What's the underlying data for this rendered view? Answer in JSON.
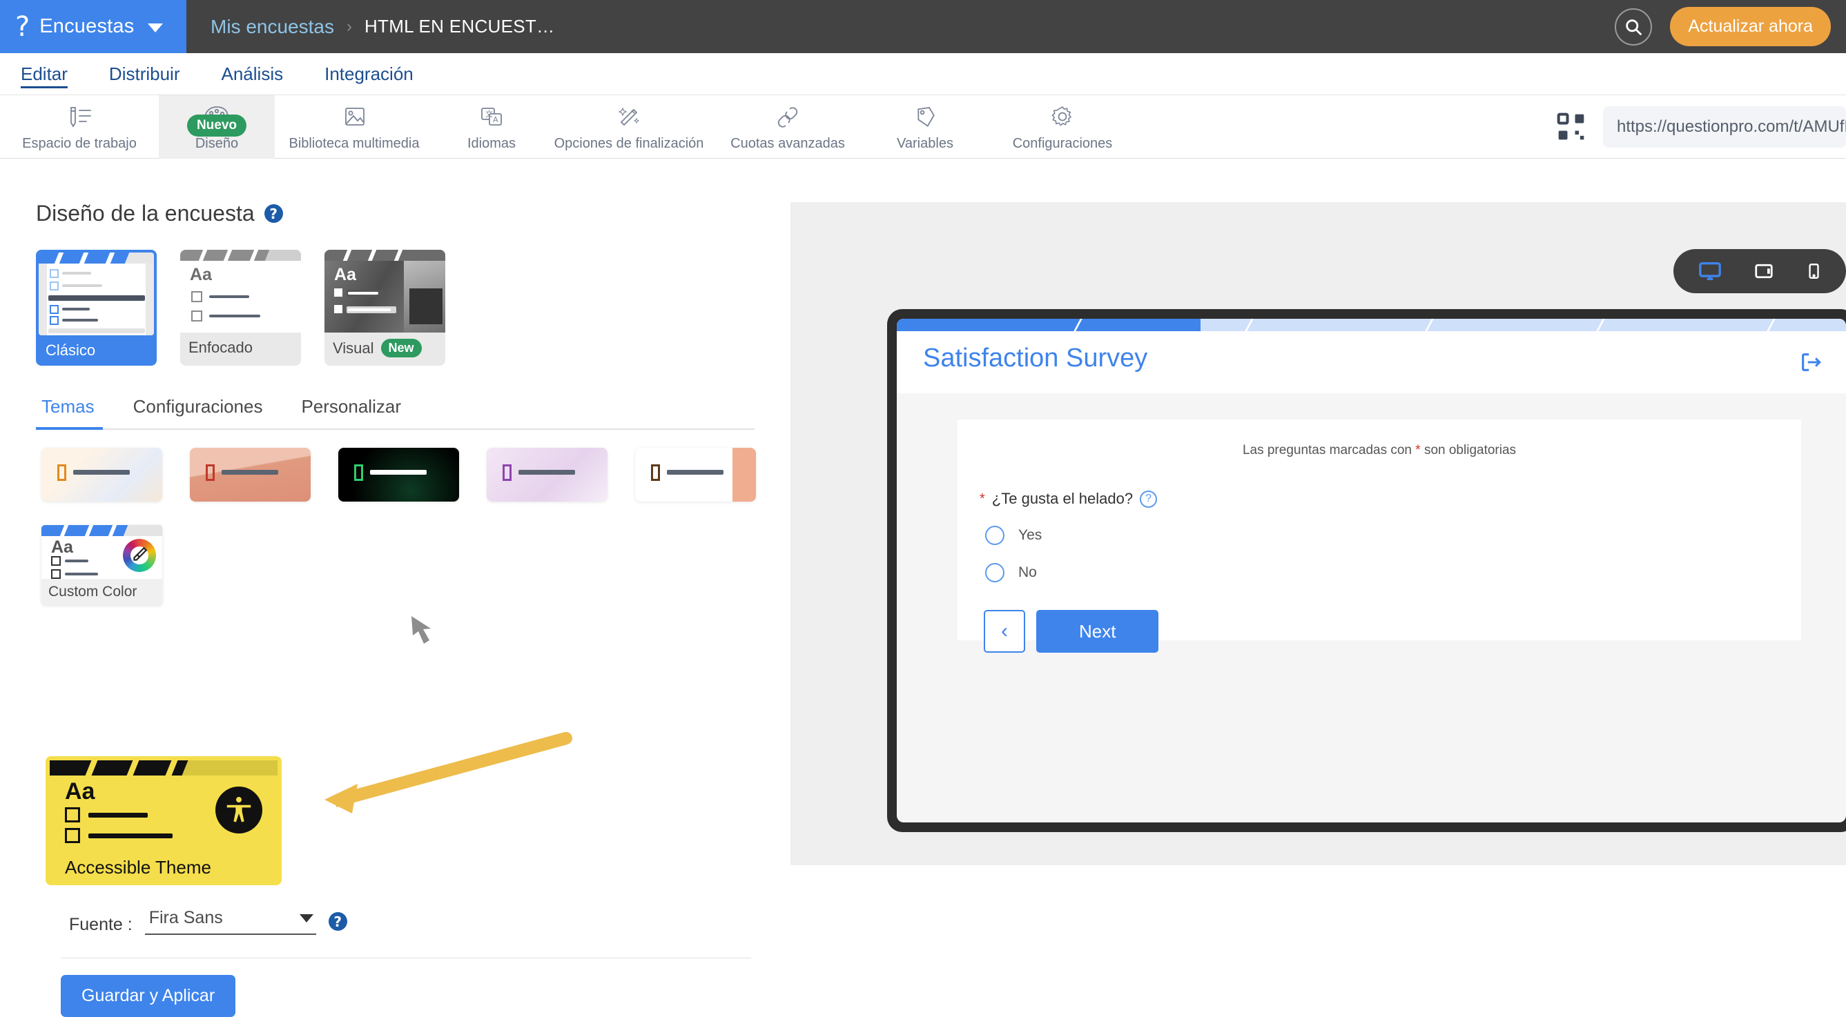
{
  "topbar": {
    "brand_logo_glyph": "?",
    "brand_label": "Encuestas",
    "caret_icon": "chevron-down-icon",
    "breadcrumb": {
      "parent": "Mis encuestas",
      "separator": "›",
      "current": "HTML EN ENCUEST…"
    },
    "search_icon": "search-icon",
    "upgrade_label": "Actualizar ahora"
  },
  "navtabs": [
    {
      "label": "Editar",
      "active": true
    },
    {
      "label": "Distribuir",
      "active": false
    },
    {
      "label": "Análisis",
      "active": false
    },
    {
      "label": "Integración",
      "active": false
    }
  ],
  "toolbar": {
    "items": [
      {
        "label": "Espacio de trabajo",
        "icon": "pencil-list-icon",
        "active": false,
        "badge": null
      },
      {
        "label": "Diseño",
        "icon": "palette-icon",
        "active": true,
        "badge": "Nuevo"
      },
      {
        "label": "Biblioteca multimedia",
        "icon": "image-icon",
        "active": false,
        "badge": null
      },
      {
        "label": "Idiomas",
        "icon": "translate-icon",
        "active": false,
        "badge": null
      },
      {
        "label": "Opciones de finalización",
        "icon": "magic-wand-icon",
        "active": false,
        "badge": null
      },
      {
        "label": "Cuotas avanzadas",
        "icon": "link-chain-icon",
        "active": false,
        "badge": null
      },
      {
        "label": "Variables",
        "icon": "tag-icon",
        "active": false,
        "badge": null
      },
      {
        "label": "Configuraciones",
        "icon": "gear-icon",
        "active": false,
        "badge": null
      }
    ],
    "qr_icon": "qr-code-icon",
    "survey_url": "https://questionpro.com/t/AMUfRZ"
  },
  "design_panel": {
    "title": "Diseño de la encuesta",
    "help_icon": "help-circle-icon",
    "layout_cards": [
      {
        "label": "Clásico",
        "selected": true,
        "badge": null,
        "aa": ""
      },
      {
        "label": "Enfocado",
        "selected": false,
        "badge": null,
        "aa": "Aa"
      },
      {
        "label": "Visual",
        "selected": false,
        "badge": "New",
        "aa": "Aa"
      }
    ],
    "subtabs": [
      {
        "label": "Temas",
        "active": true
      },
      {
        "label": "Configuraciones",
        "active": false
      },
      {
        "label": "Personalizar",
        "active": false
      }
    ],
    "theme_thumbs": [
      {
        "name": "theme-cream",
        "bg": "#fbf6ef",
        "accent": "#E08A1E",
        "line": "#5a6472"
      },
      {
        "name": "theme-terracotta",
        "bg": "#e9a995",
        "accent": "#C0392B",
        "line": "#5a6472"
      },
      {
        "name": "theme-dark-green",
        "bg": "#0a0a0a",
        "accent": "#2ECC71",
        "line": "#ffffff"
      },
      {
        "name": "theme-lilac",
        "bg": "#ecd9ef",
        "accent": "#8E44AD",
        "line": "#5a6472"
      },
      {
        "name": "theme-white-peach",
        "bg": "#ffffff",
        "accent": "#5D3A1A",
        "line": "#5a6472"
      }
    ],
    "custom_color_card": {
      "label": "Custom Color",
      "aa": "Aa",
      "icon": "color-wheel-eyedropper-icon"
    },
    "accessible_card": {
      "label": "Accessible Theme",
      "aa": "Aa",
      "icon": "accessibility-icon",
      "bg_color": "#F5DE4B"
    },
    "annotation_arrow": {
      "name": "orange-arrow-annotation",
      "color": "#EDBC4B"
    },
    "font_row": {
      "label": "Fuente :",
      "value": "Fira Sans",
      "caret_icon": "chevron-down-icon",
      "help_icon": "help-circle-icon"
    },
    "save_button": "Guardar y Aplicar"
  },
  "preview": {
    "device_toggle": [
      {
        "name": "desktop",
        "icon": "monitor-icon",
        "active": true
      },
      {
        "name": "tablet",
        "icon": "tablet-icon",
        "active": false
      },
      {
        "name": "mobile",
        "icon": "mobile-icon",
        "active": false
      }
    ],
    "survey": {
      "title": "Satisfaction Survey",
      "exit_icon": "exit-arrow-icon",
      "progress_percent": 30,
      "required_note_pre": "Las preguntas marcadas con ",
      "required_note_star": "*",
      "required_note_post": " son obligatorias",
      "question": {
        "required_star": "*",
        "text": "¿Te gusta el helado?",
        "help_icon": "help-circle-icon",
        "help_glyph": "?"
      },
      "options": [
        {
          "label": "Yes"
        },
        {
          "label": "No"
        }
      ],
      "back_button_glyph": "‹",
      "next_button": "Next"
    }
  }
}
